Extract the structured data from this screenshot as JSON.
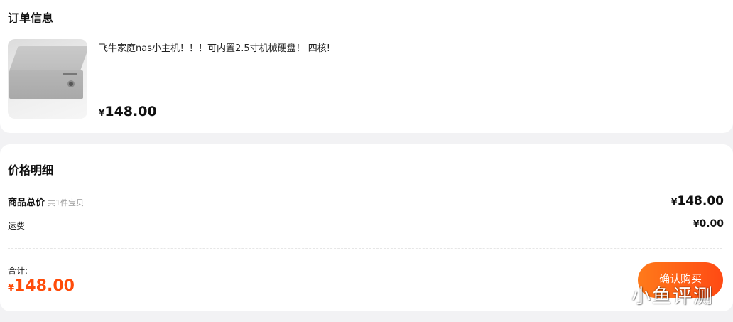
{
  "order": {
    "title": "订单信息",
    "product": {
      "title": "飞牛家庭nas小主机！！！可内置2.5寸机械硬盘！ 四核!",
      "currency": "¥",
      "price": "148.00"
    }
  },
  "price_detail": {
    "title": "价格明细",
    "goods_total_label": "商品总价",
    "goods_total_sub": "共1件宝贝",
    "goods_total_currency": "¥",
    "goods_total_value": "148.00",
    "shipping_label": "运费",
    "shipping_currency": "¥",
    "shipping_value": "0.00",
    "total_label": "合计:",
    "total_currency": "¥",
    "total_value": "148.00"
  },
  "actions": {
    "confirm_buy_label": "确认购买"
  },
  "watermark": "小鱼评测",
  "colors": {
    "accent": "#ff4c0a",
    "button_gradient_start": "#ff7a1a",
    "button_gradient_end": "#ff4a14",
    "background": "#f2f2f4"
  }
}
